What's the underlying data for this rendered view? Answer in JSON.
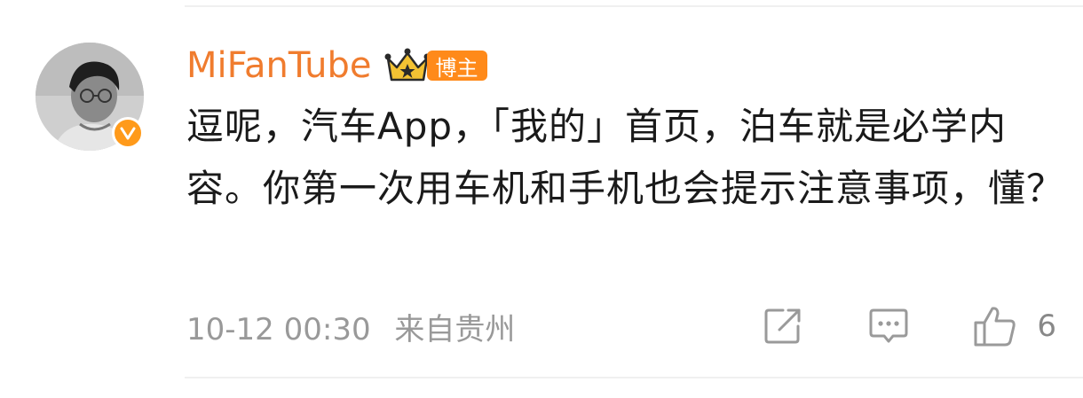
{
  "comment": {
    "author": {
      "name": "MiFanTube",
      "role_badge": "博主",
      "verified": true
    },
    "text": "逗呢，汽车App，「我的」首页，泊车就是必学内容。你第一次用车机和手机也会提示注意事项，懂？",
    "timestamp": "10-12 00:30",
    "source": "来自贵州",
    "actions": {
      "share_icon": "share-icon",
      "reply_icon": "reply-icon",
      "like_icon": "like-icon",
      "like_count": "6"
    }
  },
  "colors": {
    "username": "#f07c2e",
    "badge": "#ff8a1a",
    "body_text": "#1a1a1a",
    "meta_text": "#999999",
    "icon": "#999999"
  }
}
